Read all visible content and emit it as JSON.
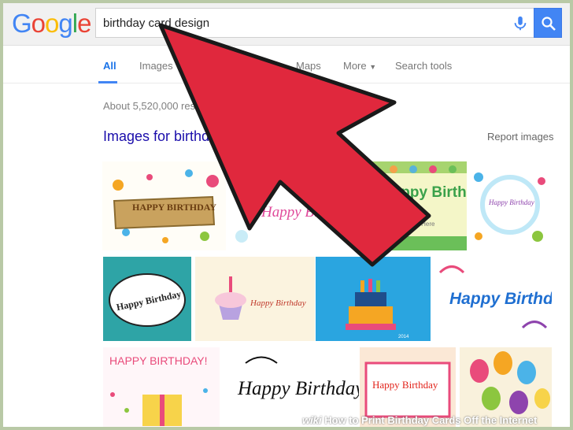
{
  "header": {
    "logo": {
      "G": "G",
      "o1": "o",
      "o2": "o",
      "g": "g",
      "l": "l",
      "e": "e"
    },
    "search_value": "birthday card design",
    "mic_icon": "microphone-icon",
    "search_icon": "search-icon"
  },
  "tabs": [
    {
      "label": "All",
      "active": true
    },
    {
      "label": "Images"
    },
    {
      "label": "Maps"
    },
    {
      "label": "More"
    },
    {
      "label": "Search tools"
    }
  ],
  "results_count": "About 5,520,000 res",
  "images_heading": "Images for birthda",
  "report_images": "Report images",
  "thumbnails": [
    {
      "text": "HAPPY BIRTHDAY"
    },
    {
      "text": "Happy Birthday"
    },
    {
      "text": "Happy Birthday",
      "subtext": "Your Text Here",
      "watermark": "shutterstock"
    },
    {
      "text": "Happy Birthday"
    },
    {
      "text": "Happy Birthday"
    },
    {
      "text": "Happy Birthday"
    },
    {
      "text": "",
      "watermark": "2014"
    },
    {
      "text": "Happy Birthday"
    },
    {
      "text": "HAPPY BIRTHDAY!"
    },
    {
      "text": "Happy Birthday"
    },
    {
      "text": "Happy Birthday"
    },
    {
      "text": ""
    }
  ],
  "footer": {
    "wiki": "wiki",
    "text": "How to Print Birthday Cards Off the Internet"
  },
  "colors": {
    "arrow": "#e0283d",
    "accent": "#4285f4",
    "frame": "#b9c9a6"
  }
}
